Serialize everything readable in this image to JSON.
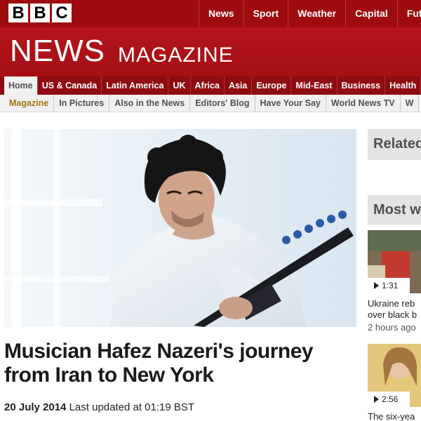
{
  "brand": {
    "letters": [
      "B",
      "B",
      "C"
    ]
  },
  "top_nav": {
    "items": [
      "News",
      "Sport",
      "Weather",
      "Capital",
      "Futur"
    ]
  },
  "masthead": {
    "news": "NEWS",
    "magazine": "MAGAZINE"
  },
  "section_nav": {
    "items": [
      "Home",
      "US & Canada",
      "Latin America",
      "UK",
      "Africa",
      "Asia",
      "Europe",
      "Mid-East",
      "Business",
      "Health"
    ],
    "active": "Home"
  },
  "sub_nav": {
    "items": [
      "Magazine",
      "In Pictures",
      "Also in the News",
      "Editors' Blog",
      "Have Your Say",
      "World News TV",
      "W"
    ],
    "active": "Magazine"
  },
  "article": {
    "headline_line1": "Musician Hafez Nazeri's journey",
    "headline_line2": "from Iran to New York",
    "date": "20 July 2014",
    "updated": "Last updated at 01:19 BST"
  },
  "sidebar": {
    "related_title": "Related",
    "most_title": "Most w",
    "stories": [
      {
        "duration": "1:31",
        "line1": "Ukraine reb",
        "line2": "over black b",
        "time": "2 hours ago"
      },
      {
        "duration": "2:56",
        "line1": "The six-yea"
      }
    ]
  },
  "colors": {
    "bbc_red": "#9e0b0f",
    "masthead_red": "#b4151b",
    "subnav_bg": "#f1f1f1",
    "active_gold": "#a3740f"
  }
}
